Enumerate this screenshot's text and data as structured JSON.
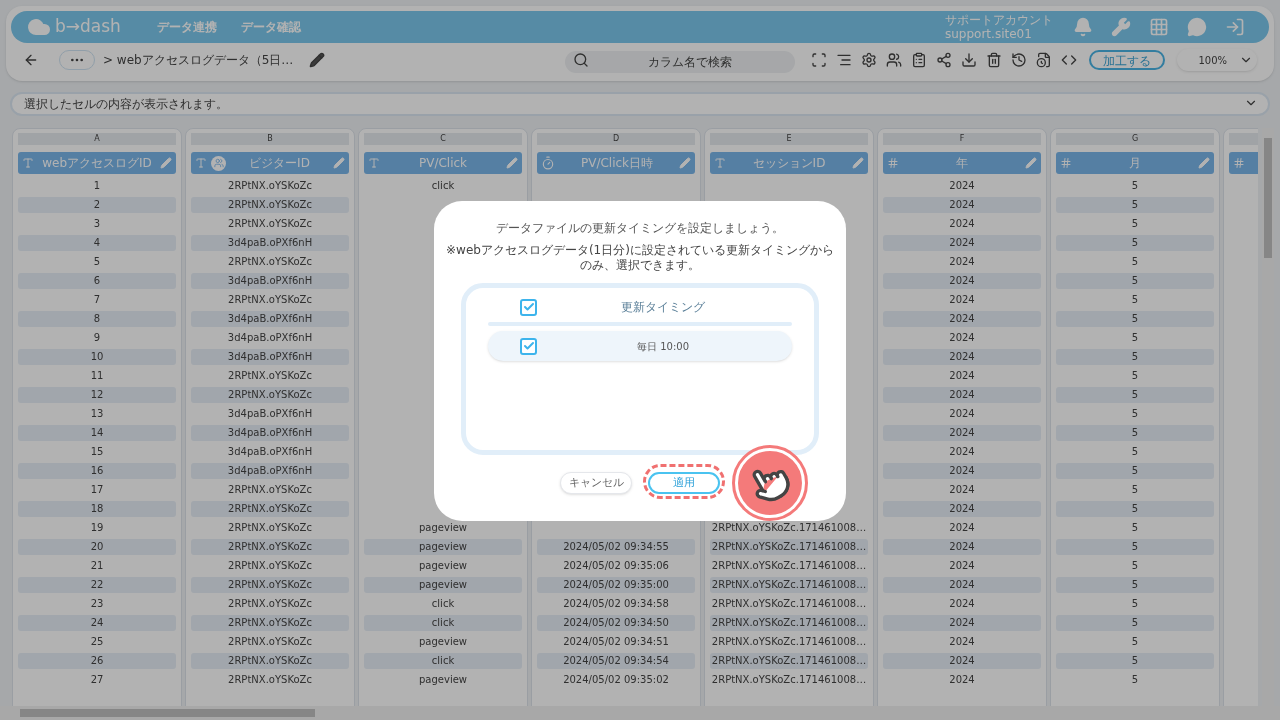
{
  "header": {
    "logo": "b→dash",
    "nav": [
      {
        "label": "データ連携"
      },
      {
        "label": "データ確認"
      }
    ],
    "account_name": "サポートアカウント",
    "account_id": "support.site01"
  },
  "toolbar": {
    "breadcrumb": "> webアクセスログデータ（5日…",
    "search": {
      "placeholder": "カラム名で検索"
    },
    "process_button": "加工する",
    "zoom": "100%"
  },
  "cell_preview": {
    "placeholder": "選択したセルの内容が表示されます。"
  },
  "table": {
    "columns": [
      {
        "letter": "A",
        "title": "webアクセスログID",
        "kind": "text",
        "cells": [
          "1",
          "2",
          "3",
          "4",
          "5",
          "6",
          "7",
          "8",
          "9",
          "10",
          "11",
          "12",
          "13",
          "14",
          "15",
          "16",
          "17",
          "18",
          "19",
          "20",
          "21",
          "22",
          "23",
          "24",
          "25",
          "26",
          "27"
        ]
      },
      {
        "letter": "B",
        "title": "ビジターID",
        "kind": "text",
        "users": true,
        "cells": [
          "2RPtNX.oYSKoZc",
          "2RPtNX.oYSKoZc",
          "2RPtNX.oYSKoZc",
          "3d4paB.oPXf6nH",
          "2RPtNX.oYSKoZc",
          "3d4paB.oPXf6nH",
          "2RPtNX.oYSKoZc",
          "3d4paB.oPXf6nH",
          "3d4paB.oPXf6nH",
          "3d4paB.oPXf6nH",
          "2RPtNX.oYSKoZc",
          "2RPtNX.oYSKoZc",
          "3d4paB.oPXf6nH",
          "3d4paB.oPXf6nH",
          "3d4paB.oPXf6nH",
          "3d4paB.oPXf6nH",
          "2RPtNX.oYSKoZc",
          "2RPtNX.oYSKoZc",
          "2RPtNX.oYSKoZc",
          "2RPtNX.oYSKoZc",
          "2RPtNX.oYSKoZc",
          "2RPtNX.oYSKoZc",
          "2RPtNX.oYSKoZc",
          "2RPtNX.oYSKoZc",
          "2RPtNX.oYSKoZc",
          "2RPtNX.oYSKoZc",
          "2RPtNX.oYSKoZc"
        ]
      },
      {
        "letter": "C",
        "title": "PV/Click",
        "kind": "text",
        "cells": [
          "click",
          null,
          null,
          null,
          null,
          null,
          null,
          null,
          null,
          null,
          null,
          null,
          null,
          null,
          null,
          null,
          null,
          null,
          "pageview",
          "pageview",
          "pageview",
          "pageview",
          "click",
          "click",
          "pageview",
          "click",
          "pageview"
        ]
      },
      {
        "letter": "D",
        "title": "PV/Click日時",
        "kind": "datetime",
        "cells": [
          null,
          null,
          null,
          null,
          null,
          null,
          null,
          null,
          null,
          null,
          null,
          null,
          null,
          null,
          null,
          null,
          null,
          null,
          null,
          "2024/05/02 09:34:55",
          "2024/05/02 09:35:06",
          "2024/05/02 09:35:00",
          "2024/05/02 09:34:58",
          "2024/05/02 09:34:50",
          "2024/05/02 09:34:51",
          "2024/05/02 09:34:54",
          "2024/05/02 09:35:02"
        ]
      },
      {
        "letter": "E",
        "title": "セッションID",
        "kind": "text",
        "cells": [
          null,
          null,
          null,
          null,
          null,
          null,
          null,
          null,
          null,
          null,
          null,
          null,
          null,
          null,
          null,
          null,
          null,
          null,
          "2RPtNX.oYSKoZc.171461008…",
          "2RPtNX.oYSKoZc.171461008…",
          "2RPtNX.oYSKoZc.171461008…",
          "2RPtNX.oYSKoZc.171461008…",
          "2RPtNX.oYSKoZc.171461008…",
          "2RPtNX.oYSKoZc.171461008…",
          "2RPtNX.oYSKoZc.171461008…",
          "2RPtNX.oYSKoZc.171461008…",
          "2RPtNX.oYSKoZc.171461008…"
        ]
      },
      {
        "letter": "F",
        "title": "年",
        "kind": "number",
        "cells": [
          "2024",
          "2024",
          "2024",
          "2024",
          "2024",
          "2024",
          "2024",
          "2024",
          "2024",
          "2024",
          "2024",
          "2024",
          "2024",
          "2024",
          "2024",
          "2024",
          "2024",
          "2024",
          "2024",
          "2024",
          "2024",
          "2024",
          "2024",
          "2024",
          "2024",
          "2024",
          "2024"
        ]
      },
      {
        "letter": "G",
        "title": "月",
        "kind": "number",
        "cells": [
          "5",
          "5",
          "5",
          "5",
          "5",
          "5",
          "5",
          "5",
          "5",
          "5",
          "5",
          "5",
          "5",
          "5",
          "5",
          "5",
          "5",
          "5",
          "5",
          "5",
          "5",
          "5",
          "5",
          "5",
          "5",
          "5",
          "5"
        ]
      },
      {
        "kind": "number"
      }
    ]
  },
  "dialog": {
    "title": "データファイルの更新タイミングを設定しましょう。",
    "note": "※webアクセスログデータ(1日分)に設定されている更新タイミングからのみ、選択できます。",
    "list_header": {
      "label": "更新タイミング",
      "checked": true
    },
    "items": [
      {
        "label": "毎日 10:00",
        "checked": true
      }
    ],
    "buttons": [
      {
        "label": "キャンセル",
        "kind": "secondary",
        "highlighted": false
      },
      {
        "label": "適用",
        "kind": "primary",
        "highlighted": true
      }
    ]
  }
}
